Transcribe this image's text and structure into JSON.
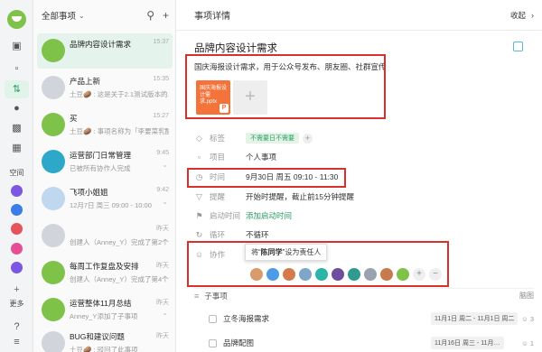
{
  "sidebar": {
    "space_label": "空间",
    "more_label": "更多",
    "space_colors": [
      "#7b57e4",
      "#3b7de8",
      "#e5545b",
      "#e64f94"
    ]
  },
  "list": {
    "header_title": "全部事项",
    "items": [
      {
        "title": "品牌内容设计需求",
        "subtitle": "",
        "time": "15:37",
        "avatar_color": "#7fc24a"
      },
      {
        "title": "产品上新",
        "subtitle": "土豆🥔 : 这是关于2.1测试版本的…",
        "time": "15:35",
        "avatar_color": "#d1d5db"
      },
      {
        "title": "买",
        "subtitle": "土豆🥔 : 事项名称为「李要菜乳酸…",
        "time": "15:27",
        "avatar_color": "#7fc24a"
      },
      {
        "title": "运营部门日常管理",
        "subtitle": "已被所有协作人完成",
        "time": "9:45",
        "avatar_color": "#2da8c8"
      },
      {
        "title": "飞项小姐姐",
        "subtitle": "12月7日 周三 09:00 - 10:00",
        "time": "9:42",
        "avatar_color": "#bfd8ef"
      },
      {
        "title": "",
        "subtitle": "创建人（Anney_Y）完成了第2个事…",
        "time": "昨天",
        "avatar_color": "#d1d5db"
      },
      {
        "title": "每周工作复盘及安排",
        "subtitle": "创建人（Anney_Y）完成了第4个事…",
        "time": "昨天",
        "avatar_color": "#7fc24a"
      },
      {
        "title": "运营整体11月总结",
        "subtitle": "Anney_Y添加了子事项",
        "time": "昨天",
        "avatar_color": "#7fc24a"
      },
      {
        "title": "BUG和建议问题",
        "subtitle": "土豆🥔 : 驳回了此事项",
        "time": "昨天",
        "avatar_color": "#d1d5db"
      }
    ]
  },
  "detail": {
    "header_title": "事项详情",
    "collapse_label": "收起",
    "task_title": "品牌内容设计需求",
    "description": "国庆海报设计需求，用于公众号发布、朋友圈、社群宣传",
    "file_thumb_text": "国庆海报设计需求.pptx",
    "file_badge": "P",
    "tag_label": "标签",
    "tag_value": "不需要日不需要",
    "project_label": "项目",
    "project_value": "个人事项",
    "time_label": "时间",
    "time_value": "9月30日 周五 09:10 - 11:30",
    "reminder_label": "提醒",
    "reminder_value": "开始时提醒，截止前15分钟提醒",
    "start_label": "启动时间",
    "start_value": "添加启动时间",
    "repeat_label": "循环",
    "repeat_value": "不循环",
    "collab_label": "协作",
    "tooltip_pre": "将“",
    "tooltip_name": "陈同学",
    "tooltip_post": "”设为责任人",
    "collaborator_colors": [
      "#d99a6c",
      "#4c9be8",
      "#d47a4b",
      "#7fa6c9",
      "#2bb5a8",
      "#6e4f9e",
      "#2f9b8f",
      "#9aa3ad",
      "#c9794e",
      "#7fc24a"
    ],
    "subtasks_label": "子事项",
    "subtasks_action": "脑图",
    "subtasks": [
      {
        "name": "立冬海报需求",
        "date": "11月1日 周二 - 11月1日 周二",
        "count": "3"
      },
      {
        "name": "品牌配图",
        "date": "11月16日 周三 - 11月…",
        "count": "1"
      }
    ]
  }
}
